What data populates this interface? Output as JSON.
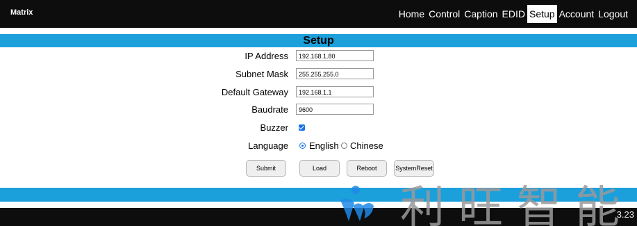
{
  "brand": "Matrix",
  "nav": {
    "items": [
      "Home",
      "Control",
      "Caption",
      "EDID",
      "Setup",
      "Account",
      "Logout"
    ],
    "active": "Setup"
  },
  "page": {
    "title": "Setup"
  },
  "form": {
    "ip_address": {
      "label": "IP Address",
      "value": "192.168.1.80"
    },
    "subnet_mask": {
      "label": "Subnet Mask",
      "value": "255.255.255.0"
    },
    "default_gateway": {
      "label": "Default Gateway",
      "value": "192.168.1.1"
    },
    "baudrate": {
      "label": "Baudrate",
      "value": "9600"
    },
    "buzzer": {
      "label": "Buzzer",
      "checked": true
    },
    "language": {
      "label": "Language",
      "options": [
        "English",
        "Chinese"
      ],
      "selected": "English"
    }
  },
  "buttons": {
    "submit": "Submit",
    "load": "Load",
    "reboot": "Reboot",
    "system_reset": "SystemReset"
  },
  "footer": {
    "version": "3.23"
  },
  "watermark": {
    "text": "利旺智能"
  },
  "colors": {
    "accent_band": "#1ba0dc",
    "bar": "#0d0d0d",
    "control_blue": "#1a73e8"
  }
}
